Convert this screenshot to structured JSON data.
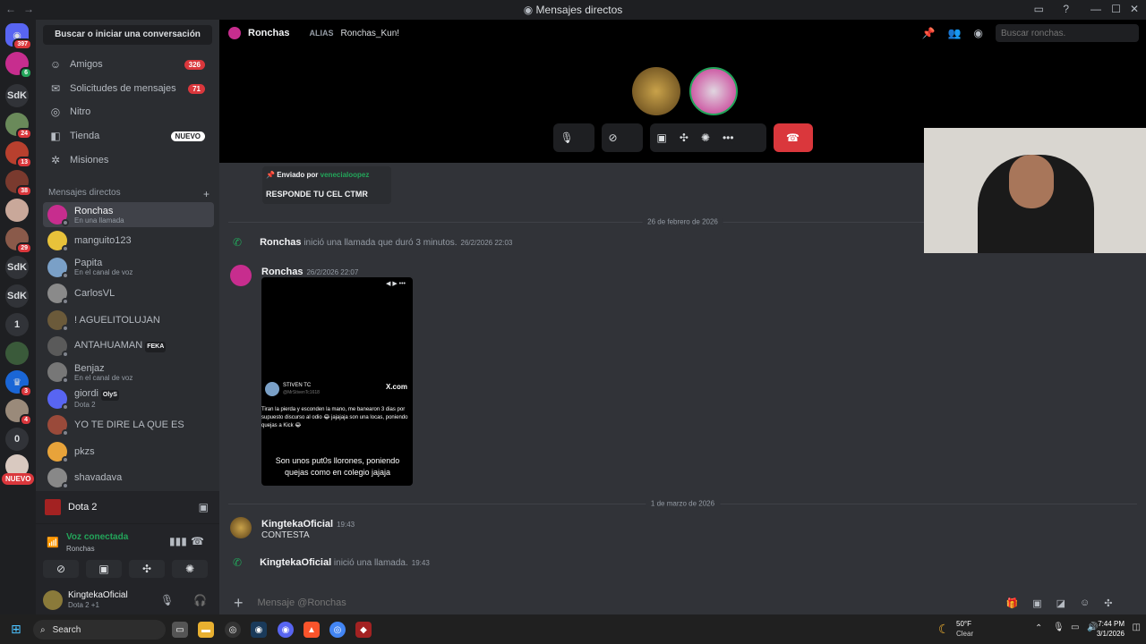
{
  "window": {
    "title": "Mensajes directos"
  },
  "servers": [
    {
      "label": "",
      "badge": "397"
    },
    {
      "label": "",
      "badge": ""
    },
    {
      "label": "SdK",
      "badge": ""
    },
    {
      "label": "",
      "badge": "24"
    },
    {
      "label": "",
      "badge": "13"
    },
    {
      "label": "",
      "badge": "38"
    },
    {
      "label": "",
      "badge": ""
    },
    {
      "label": "",
      "badge": "29"
    },
    {
      "label": "SdK",
      "badge": ""
    },
    {
      "label": "SdK",
      "badge": ""
    },
    {
      "label": "1",
      "badge": ""
    },
    {
      "label": "",
      "badge": ""
    },
    {
      "label": "",
      "badge": "3"
    },
    {
      "label": "",
      "badge": "4"
    },
    {
      "label": "0",
      "badge": ""
    },
    {
      "label": "",
      "badge": ""
    }
  ],
  "servers_new_label": "NUEVO",
  "sidebar": {
    "search_label": "Buscar o iniciar una conversación",
    "nav": [
      {
        "label": "Amigos",
        "badge": "326"
      },
      {
        "label": "Solicitudes de mensajes",
        "badge": "71"
      },
      {
        "label": "Nitro",
        "badge": ""
      },
      {
        "label": "Tienda",
        "badge": "NUEVO"
      },
      {
        "label": "Misiones",
        "badge": ""
      }
    ],
    "dm_header": "Mensajes directos",
    "dm_add": "+",
    "dms": [
      {
        "name": "Ronchas",
        "sub": "En una llamada",
        "tag": "",
        "color": "#c72d8e"
      },
      {
        "name": "manguito123",
        "sub": "",
        "tag": "",
        "color": "#e8c23a"
      },
      {
        "name": "Papita",
        "sub": "En el canal de voz",
        "tag": "",
        "color": "#7aa0c7"
      },
      {
        "name": "CarlosVL",
        "sub": "",
        "tag": "",
        "color": "#8a8a8a"
      },
      {
        "name": "! AGUELITOLUJAN",
        "sub": "",
        "tag": "",
        "color": "#6b5a3a"
      },
      {
        "name": "ANTAHUAMAN",
        "sub": "",
        "tag": "FEKA",
        "color": "#5a5a5a"
      },
      {
        "name": "Benjaz",
        "sub": "En el canal de voz",
        "tag": "",
        "color": "#777"
      },
      {
        "name": "giordi",
        "sub": "Dota 2",
        "tag": "OlyS",
        "color": "#5865f2"
      },
      {
        "name": "YO TE DIRE LA QUE ES",
        "sub": "",
        "tag": "",
        "color": "#9a4a3a"
      },
      {
        "name": "pkzs",
        "sub": "",
        "tag": "",
        "color": "#e8a33a"
      },
      {
        "name": "shavadava",
        "sub": "",
        "tag": "",
        "color": "#888"
      }
    ],
    "game": "Dota 2",
    "voice": {
      "status": "Voz conectada",
      "channel": "Ronchas"
    },
    "user": {
      "name": "KingtekaOficial",
      "activity": "Dota 2 +1"
    }
  },
  "header": {
    "name": "Ronchas",
    "alias_label": "ALIAS",
    "alias": "Ronchas_Kun!",
    "search_placeholder": "Buscar ronchas."
  },
  "messages": {
    "pinned": {
      "label": "Enviado por",
      "by": "venecialoopez",
      "text": "RESPONDE TU CEL CTMR"
    },
    "date1": "26 de febrero de 2026",
    "call1": {
      "author": "Ronchas",
      "text": "inició una llamada que duró 3 minutos.",
      "time": "26/2/2026 22:03"
    },
    "post": {
      "author": "Ronchas",
      "time": "26/2/2026 22:07",
      "embed_user": "STIVEN TC",
      "embed_handle": "@MrStivenTc1618",
      "embed_site": "X.com",
      "embed_text": "Tiran la pierda y esconden la mano, me banearon 3 dias por supuesto discurso al odio 😂 jajajaja son una locas, poniendo quejas a Kick 😂",
      "embed_caption": "Son unos put0s llorones, poniendo quejas como en colegio jajaja"
    },
    "date2": "1 de marzo de 2026",
    "msg2": {
      "author": "KingtekaOficial",
      "time": "19:43",
      "text": "CONTESTA"
    },
    "call2": {
      "author": "KingtekaOficial",
      "text": "inició una llamada.",
      "time": "19:43"
    }
  },
  "composer": {
    "placeholder": "Mensaje @Ronchas"
  },
  "taskbar": {
    "search": "Search",
    "weather_temp": "50°F",
    "weather_desc": "Clear",
    "time": "7:44 PM",
    "date": "3/1/2026"
  }
}
